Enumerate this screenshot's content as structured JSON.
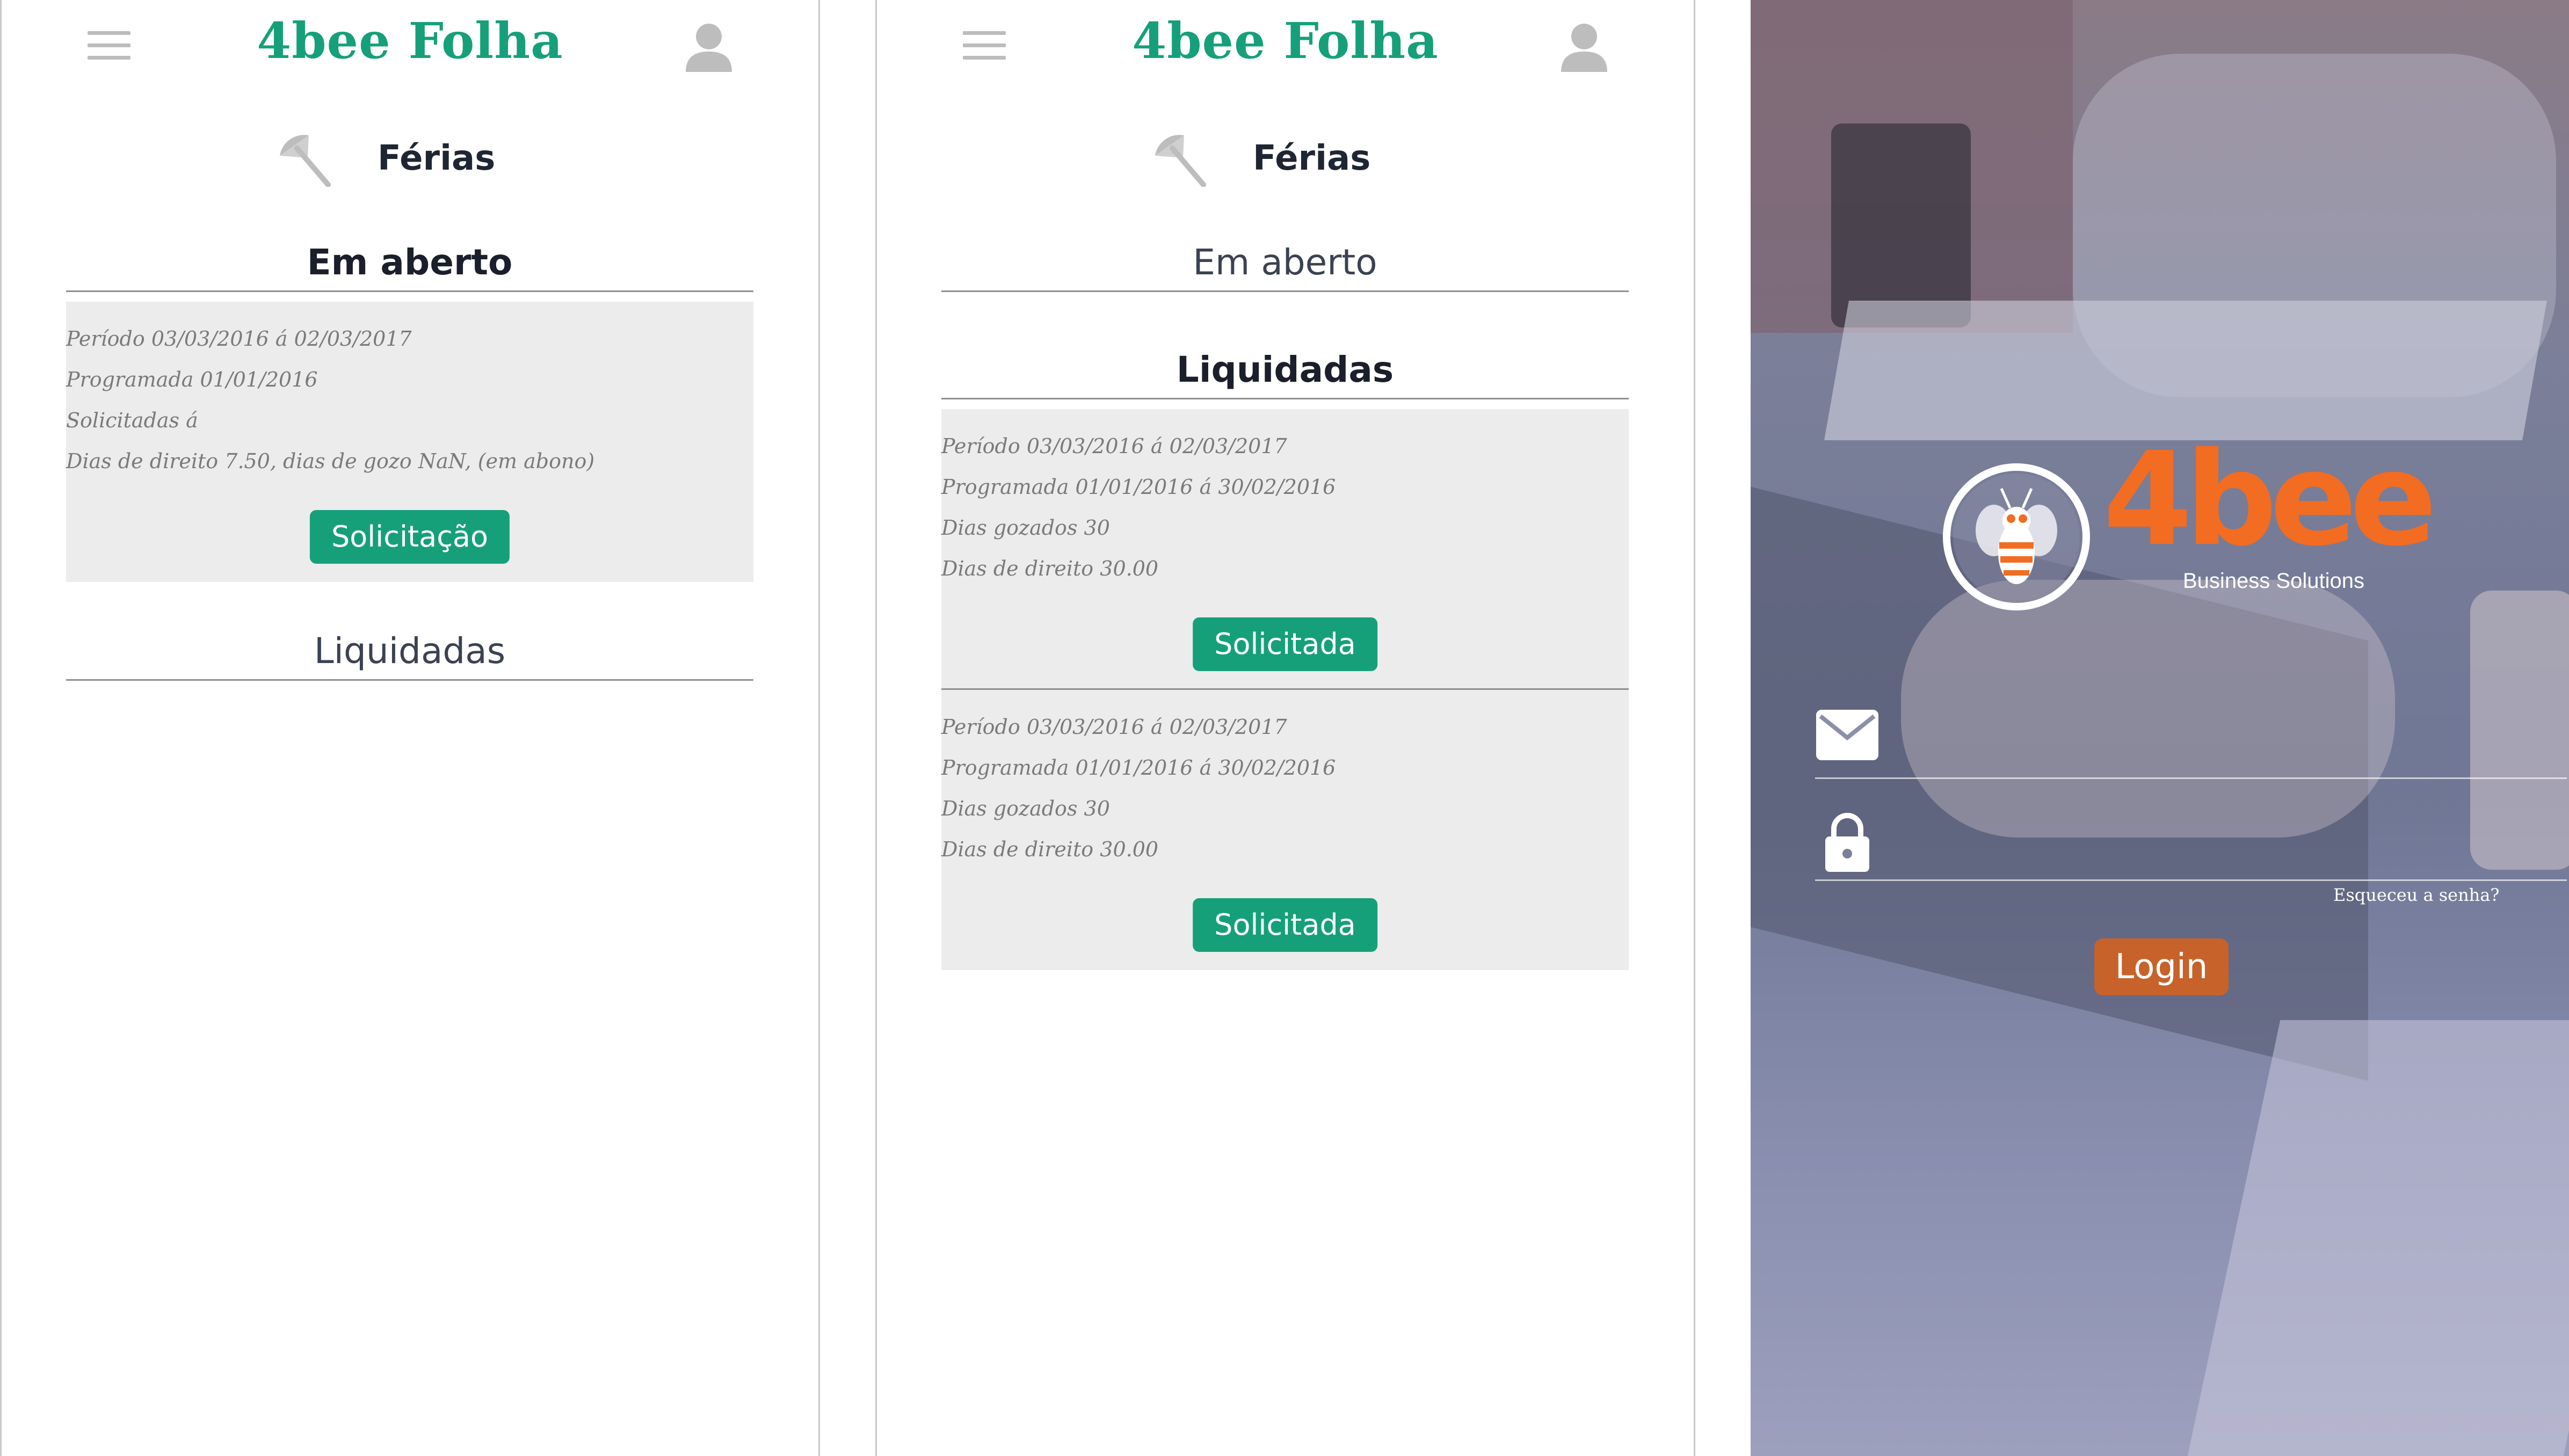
{
  "app": {
    "title": "4bee Folha",
    "accent_color": "#16a079"
  },
  "screen1": {
    "section_title": "Férias",
    "group_open_title": "Em aberto",
    "group_settled_title": "Liquidadas",
    "open_card": {
      "lines": [
        "Período 03/03/2016 á 02/03/2017",
        "Programada 01/01/2016",
        "Solicitadas á",
        "Dias de direito 7.50, dias de gozo NaN, (em abono)"
      ],
      "button_label": "Solicitação"
    }
  },
  "screen2": {
    "section_title": "Férias",
    "group_open_title": "Em aberto",
    "group_settled_title": "Liquidadas",
    "settled_cards": [
      {
        "lines": [
          "Período 03/03/2016 á 02/03/2017",
          "Programada 01/01/2016 á 30/02/2016",
          "Dias gozados 30",
          "Dias de direito 30.00"
        ],
        "button_label": "Solicitada"
      },
      {
        "lines": [
          "Período 03/03/2016 á 02/03/2017",
          "Programada 01/01/2016 á 30/02/2016",
          "Dias gozados 30",
          "Dias de direito 30.00"
        ],
        "button_label": "Solicitada"
      }
    ]
  },
  "login": {
    "brand_name": "4bee",
    "brand_tagline": "Business Solutions",
    "brand_color": "#f26c22",
    "forgot_password": "Esqueceu a senha?",
    "login_button": "Login",
    "icons": [
      "bee-logo-icon",
      "mail-icon",
      "lock-icon"
    ]
  }
}
